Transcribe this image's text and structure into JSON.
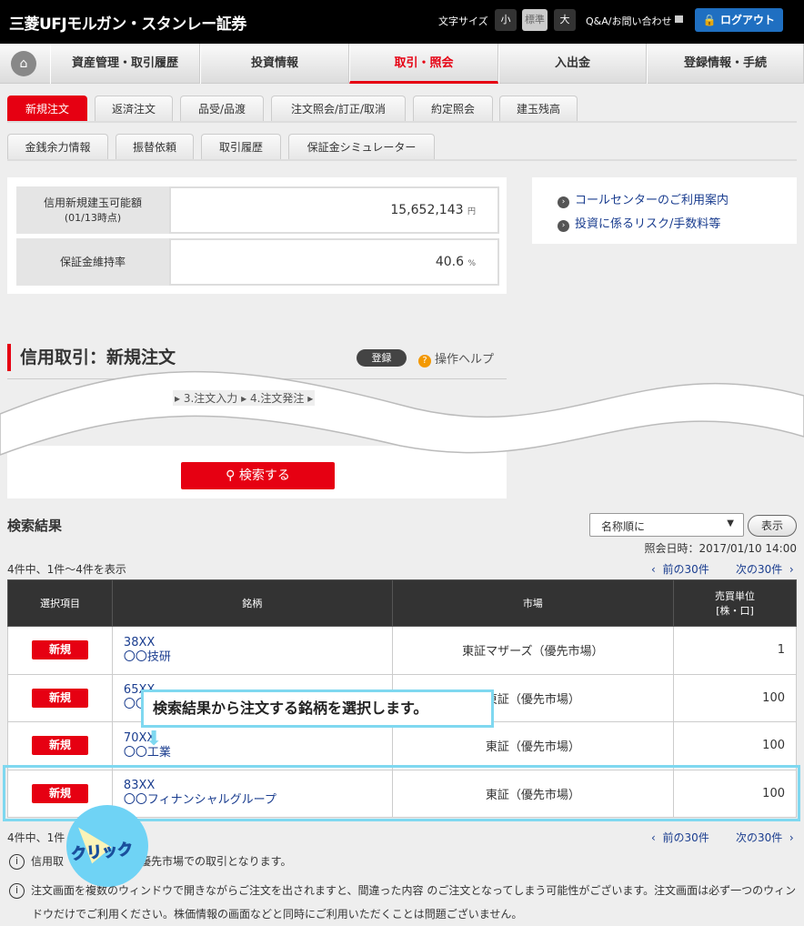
{
  "header": {
    "logo": "三菱UFJモルガン・スタンレー証券",
    "font_size_label": "文字サイズ",
    "font_sizes": [
      "小",
      "標準",
      "大"
    ],
    "qa": "Q&A/お問い合わせ",
    "logout": "ログアウト"
  },
  "nav": [
    "資産管理・取引履歴",
    "投資情報",
    "取引・照会",
    "入出金",
    "登録情報・手続"
  ],
  "tabs1": [
    "新規注文",
    "返済注文",
    "品受/品渡",
    "注文照会/訂正/取消",
    "約定照会",
    "建玉残高"
  ],
  "tabs2": [
    "金銭余力情報",
    "振替依頼",
    "取引履歴",
    "保証金シミュレーター"
  ],
  "summary": {
    "label1": "信用新規建玉可能額",
    "label1_sub": "(01/13時点)",
    "value1": "15,652,143",
    "unit1": "円",
    "label2": "保証金維持率",
    "value2": "40.6",
    "unit2": "%"
  },
  "links": [
    "コールセンターのご利用案内",
    "投資に係るリスク/手数料等"
  ],
  "page": {
    "title": "信用取引：新規注文",
    "register": "登録",
    "help": "操作ヘルプ",
    "steps": [
      "3.注文入力",
      "4.注文発注"
    ],
    "search_button": "検索する"
  },
  "results": {
    "title": "検索結果",
    "sort": "名称順に",
    "show": "表示",
    "query_time": "照会日時：2017/01/10 14:00",
    "count": "4件中、1件～4件を表示",
    "count_bottom": "4件中、1件",
    "prev": "前の30件",
    "next": "次の30件",
    "headers": [
      "選択項目",
      "銘柄",
      "市場",
      "売買単位\n[株・口]"
    ],
    "rows": [
      {
        "btn": "新規",
        "code": "38XX",
        "name": "〇〇技研",
        "market": "東証マザーズ（優先市場）",
        "unit": "1"
      },
      {
        "btn": "新規",
        "code": "65XX",
        "name": "〇〇",
        "market": "東証（優先市場）",
        "unit": "100"
      },
      {
        "btn": "新規",
        "code": "70XX",
        "name": "〇〇工業",
        "market": "東証（優先市場）",
        "unit": "100"
      },
      {
        "btn": "新規",
        "code": "83XX",
        "name": "〇〇フィナンシャルグループ",
        "market": "東証（優先市場）",
        "unit": "100"
      }
    ]
  },
  "annotation": {
    "callout": "検索結果から注文する銘柄を選択します。",
    "click": "クリック"
  },
  "notes": [
    "信用取　　　　　社の優先市場での取引となります。",
    "注文画面を複数のウィンドウで開きながらご注文を出されますと、間違った内容 のご注文となってしまう可能性がございます。注文画面は必ず一つのウィンドウだけでご利用ください。株価情報の画面などと同時にご利用いただくことは問題ございません。"
  ]
}
